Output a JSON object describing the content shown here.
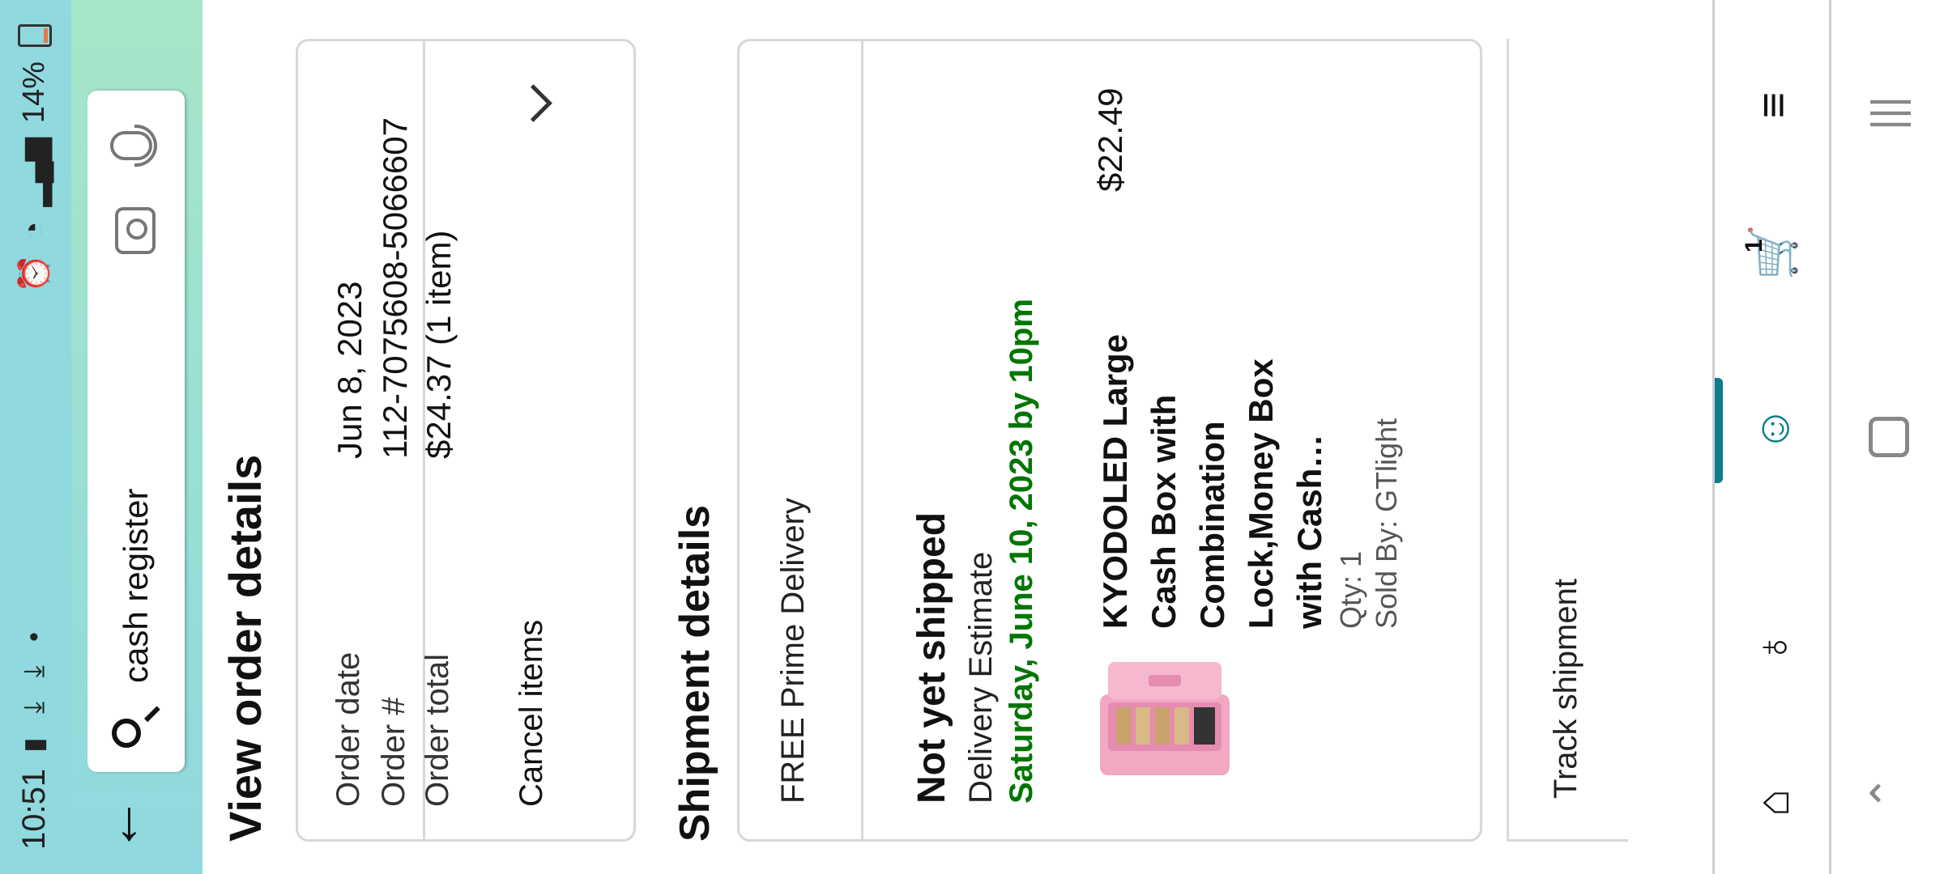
{
  "status_bar": {
    "time": "10:51",
    "left_icons": "▮ ⤓ ⤓ •",
    "battery": "14%"
  },
  "search": {
    "query": "cash register"
  },
  "page": {
    "title": "View order details"
  },
  "summary": {
    "order_date_label": "Order date",
    "order_date": "Jun 8, 2023",
    "order_number_label": "Order #",
    "order_number": "112-7075608-5066607",
    "order_total_label": "Order total",
    "order_total": "$24.37 (1 item)",
    "cancel_label": "Cancel items"
  },
  "shipment": {
    "section_title": "Shipment details",
    "delivery_type": "FREE Prime Delivery",
    "status": "Not yet shipped",
    "estimate_label": "Delivery Estimate",
    "estimate_date": "Saturday, June 10, 2023 by 10pm",
    "product_name": "KYODOLED Large Cash Box with Combination Lock,Money Box with Cash…",
    "price": "$22.49",
    "qty": "Qty: 1",
    "sold_by": "Sold By: GTlight"
  },
  "actions": {
    "track": "Track shipment"
  },
  "bottom_nav": {
    "cart_count": "1"
  }
}
